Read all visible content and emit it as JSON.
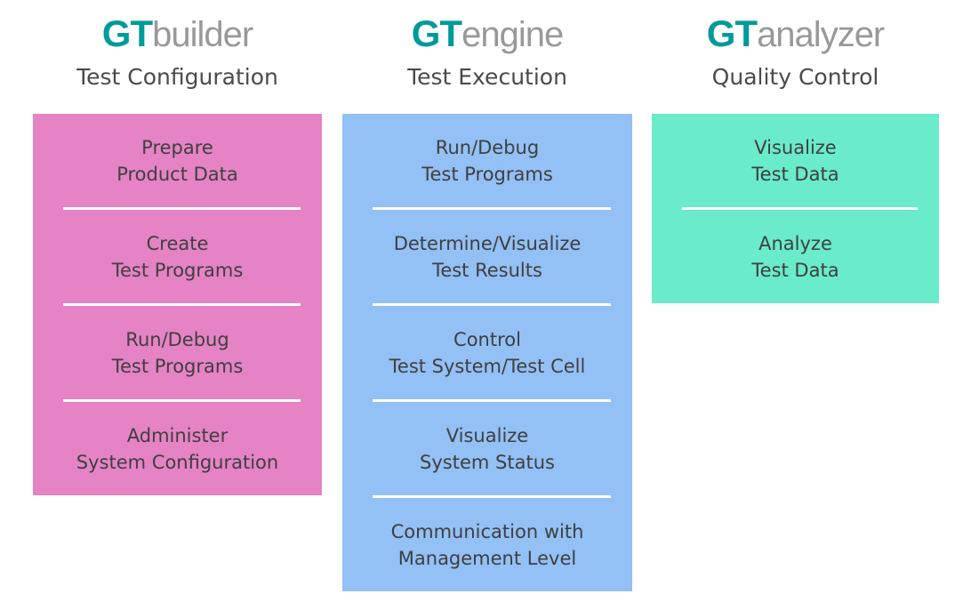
{
  "colors": {
    "brand_teal": "#009a9a",
    "brand_gray": "#999999",
    "builder": "#e583c5",
    "engine": "#93c0f5",
    "analyzer": "#6aebc9"
  },
  "columns": [
    {
      "logo_prefix": "GT",
      "logo_name": "builder",
      "subtitle": "Test Configuration",
      "items": [
        [
          "Prepare",
          "Product Data"
        ],
        [
          "Create",
          "Test Programs"
        ],
        [
          "Run/Debug",
          "Test Programs"
        ],
        [
          "Administer",
          "System Configuration"
        ]
      ]
    },
    {
      "logo_prefix": "GT",
      "logo_name": "engine",
      "subtitle": "Test Execution",
      "items": [
        [
          "Run/Debug",
          "Test Programs"
        ],
        [
          "Determine/Visualize",
          "Test Results"
        ],
        [
          "Control",
          "Test System/Test Cell"
        ],
        [
          "Visualize",
          "System Status"
        ],
        [
          "Communication with",
          "Management Level"
        ]
      ]
    },
    {
      "logo_prefix": "GT",
      "logo_name": "analyzer",
      "subtitle": "Quality Control",
      "items": [
        [
          "Visualize",
          "Test Data"
        ],
        [
          "Analyze",
          "Test Data"
        ]
      ]
    }
  ]
}
